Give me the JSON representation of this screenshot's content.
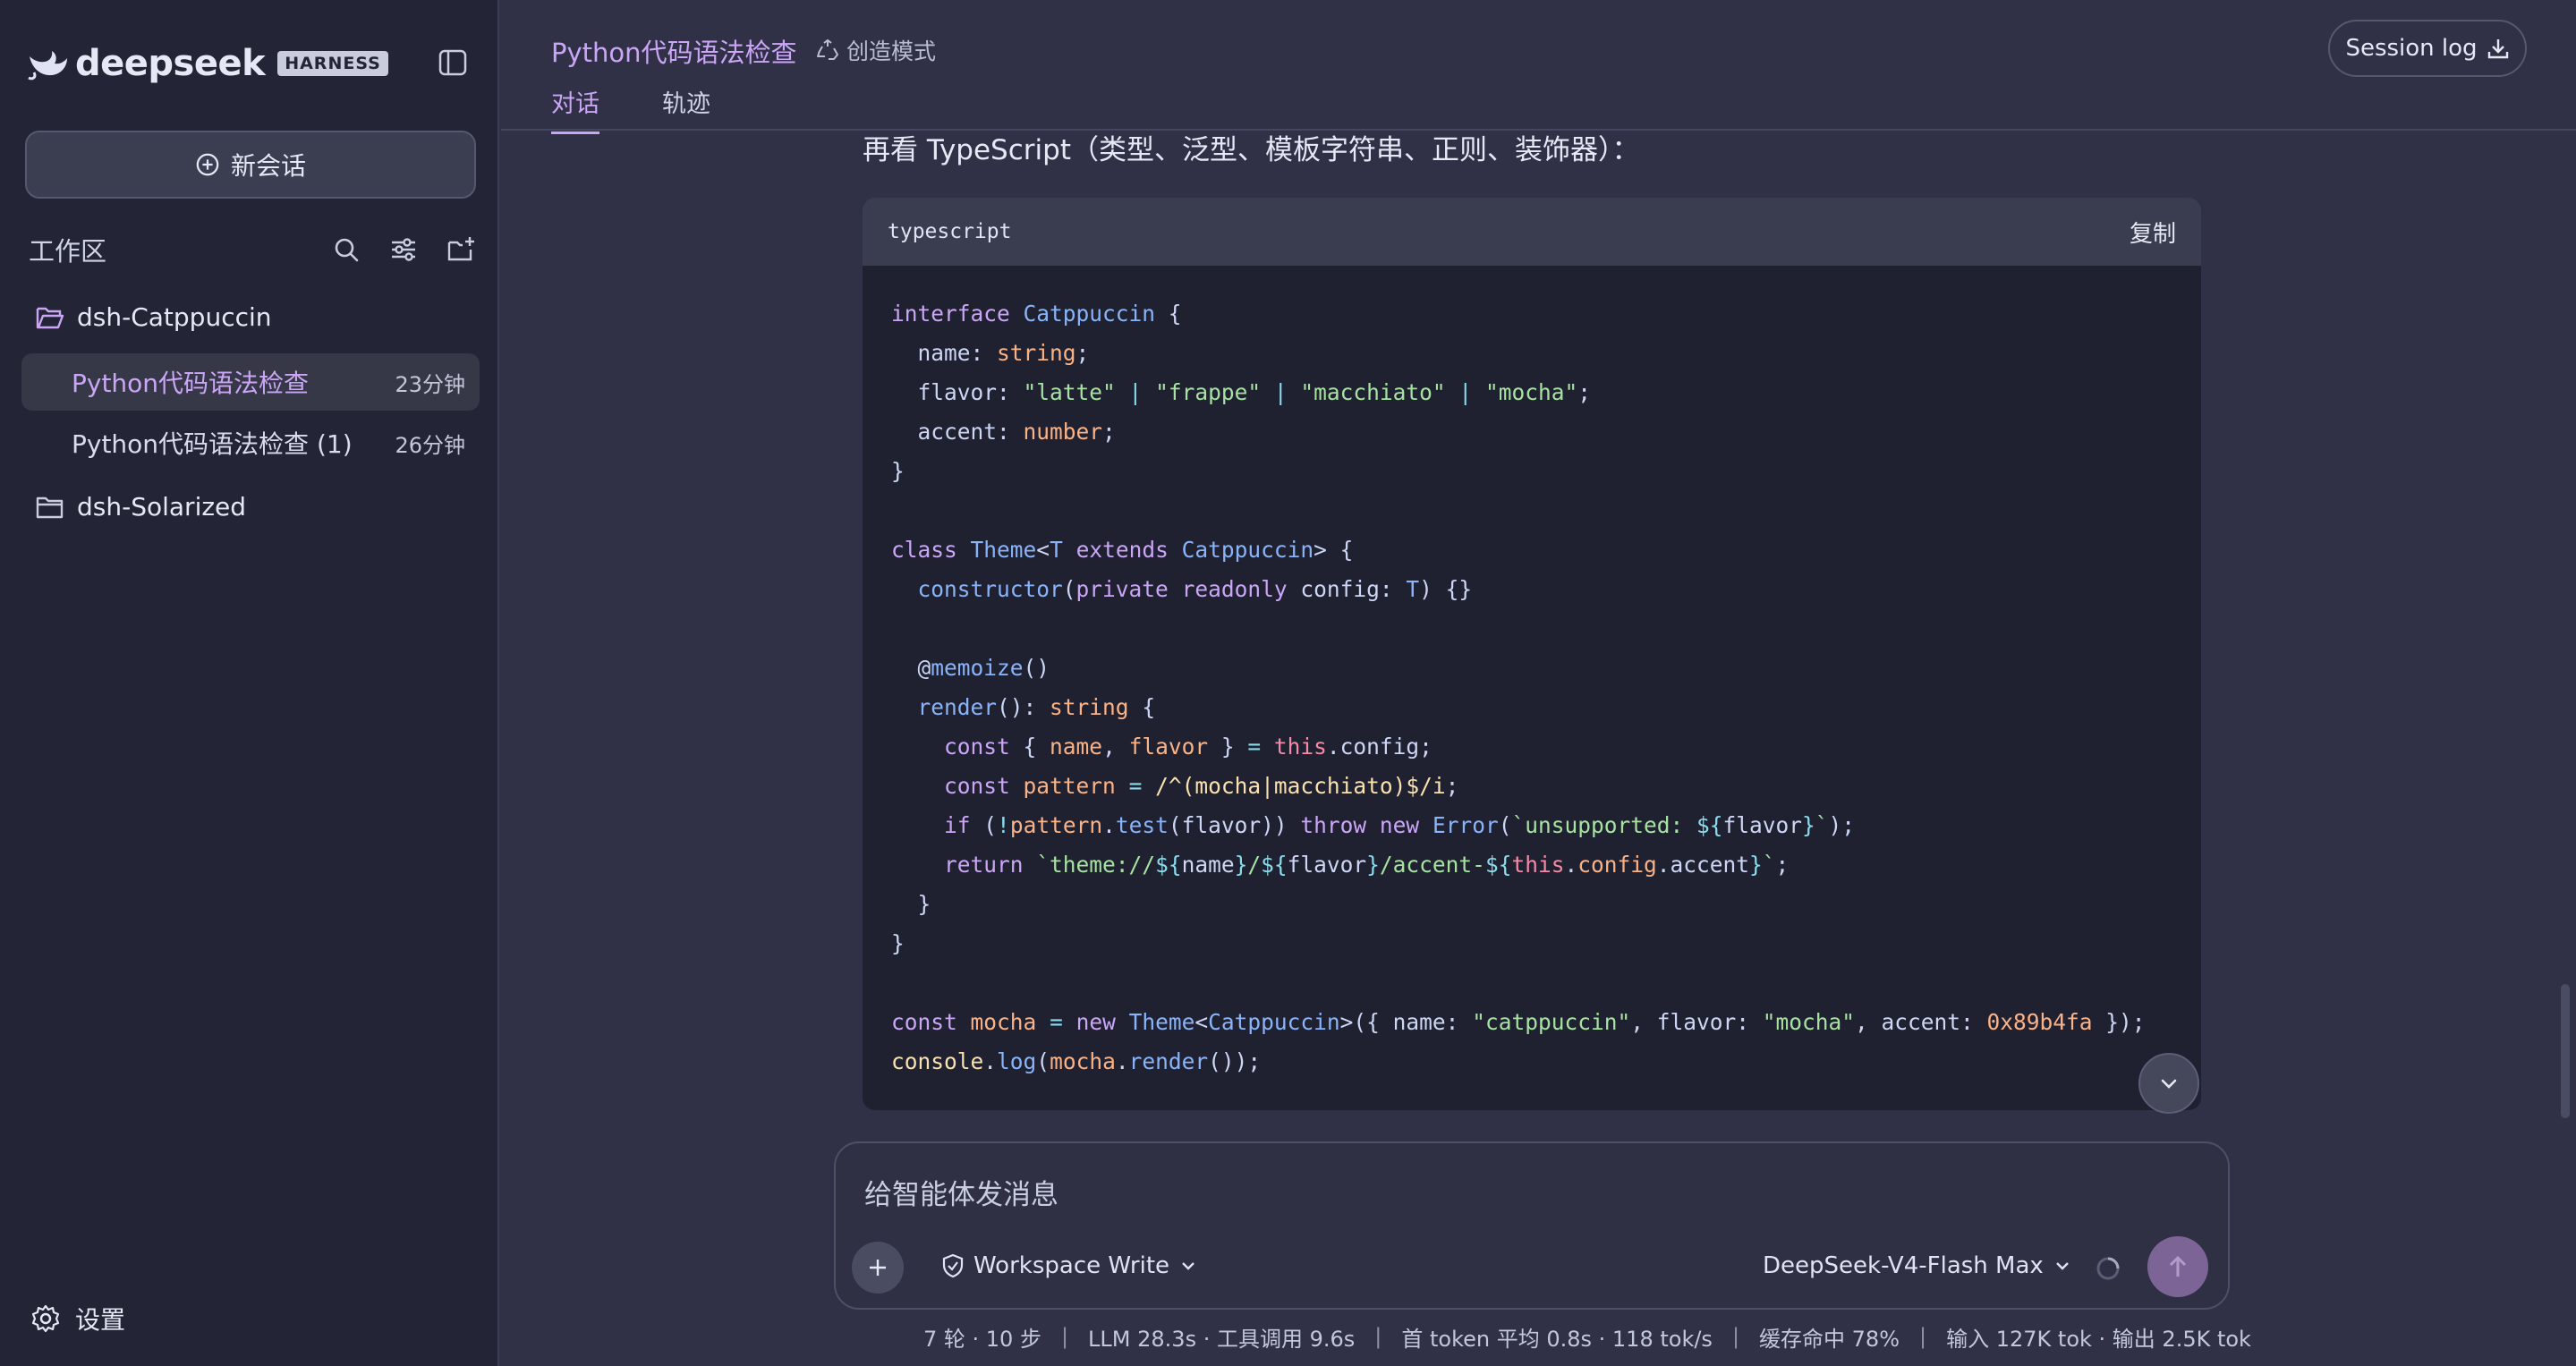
{
  "sidebar": {
    "brand": {
      "wordmark": "deepseek",
      "badge": "HARNESS"
    },
    "new_chat_label": "新会话",
    "workspace_title": "工作区",
    "folders": [
      {
        "name": "dsh-Catppuccin",
        "sessions": [
          {
            "title": "Python代码语法检查",
            "time": "23分钟",
            "active": true
          },
          {
            "title": "Python代码语法检查 (1)",
            "time": "26分钟",
            "active": false
          }
        ]
      },
      {
        "name": "dsh-Solarized",
        "sessions": []
      }
    ],
    "settings_label": "设置"
  },
  "header": {
    "title": "Python代码语法检查",
    "mode": "创造模式",
    "tabs": [
      {
        "label": "对话",
        "active": true
      },
      {
        "label": "轨迹",
        "active": false
      }
    ],
    "session_log_label": "Session log"
  },
  "message": {
    "intro": "再看 TypeScript（类型、泛型、模板字符串、正则、装饰器）：",
    "code_block": {
      "language": "typescript",
      "copy_label": "复制"
    }
  },
  "composer": {
    "placeholder": "给智能体发消息",
    "permission": "Workspace Write",
    "model": "DeepSeek-V4-Flash Max"
  },
  "status": {
    "turns": "7 轮 · 10 步",
    "llm": "LLM 28.3s · 工具调用 9.6s",
    "first_token": "首 token 平均 0.8s · 118 tok/s",
    "cache": "缓存命中 78%",
    "tokens": "输入 127K tok · 输出 2.5K tok"
  },
  "colors": {
    "accent": "#cba6f7",
    "background": "#303146",
    "sidebar": "#232435",
    "code_bg": "#1f2030"
  }
}
